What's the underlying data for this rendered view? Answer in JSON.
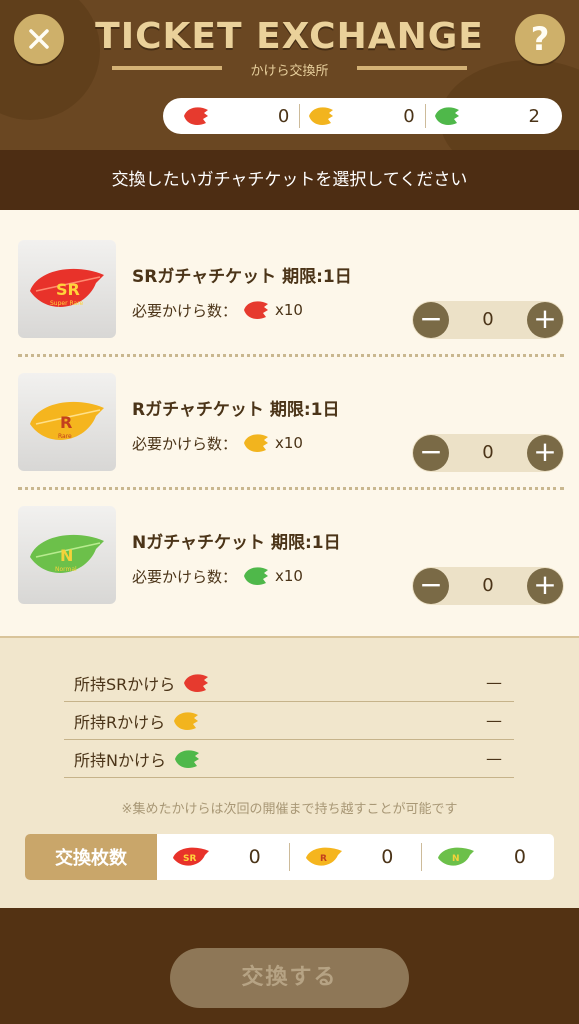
{
  "header": {
    "title": "TICKET EXCHANGE",
    "subtitle": "かけら交換所",
    "close_icon": "close-icon",
    "help_icon": "help-icon",
    "balances": [
      {
        "icon": "red-leaf-fragment-icon",
        "value": "0",
        "color": "#e63a2e"
      },
      {
        "icon": "yellow-leaf-fragment-icon",
        "value": "0",
        "color": "#f2b41e"
      },
      {
        "icon": "green-leaf-fragment-icon",
        "value": "2",
        "color": "#4fb84a"
      }
    ]
  },
  "banner": "交換したいガチャチケットを選択してください",
  "items": [
    {
      "name": "SRガチャチケット 期限:1日",
      "req_label": "必要かけら数：",
      "req_qty": "x10",
      "count": "0",
      "leaf_color": "#e8322a",
      "leaf_letter": "SR",
      "leaf_word": "Super Rare"
    },
    {
      "name": "Rガチャチケット 期限:1日",
      "req_label": "必要かけら数：",
      "req_qty": "x10",
      "count": "0",
      "leaf_color": "#f5b51e",
      "leaf_letter": "R",
      "leaf_word": "Rare"
    },
    {
      "name": "Nガチャチケット 期限:1日",
      "req_label": "必要かけら数：",
      "req_qty": "x10",
      "count": "0",
      "leaf_color": "#6cc04a",
      "leaf_letter": "N",
      "leaf_word": "Normal"
    }
  ],
  "owned": [
    {
      "label": "所持SRかけら",
      "value": "—"
    },
    {
      "label": "所持Rかけら",
      "value": "—"
    },
    {
      "label": "所持Nかけら",
      "value": "—"
    }
  ],
  "note": "※集めたかけらは次回の開催まで持ち越すことが可能です",
  "exchange_count": {
    "label": "交換枚数",
    "cells": [
      {
        "letter": "SR",
        "value": "0"
      },
      {
        "letter": "R",
        "value": "0"
      },
      {
        "letter": "N",
        "value": "0"
      }
    ]
  },
  "exchange_button": "交換する"
}
